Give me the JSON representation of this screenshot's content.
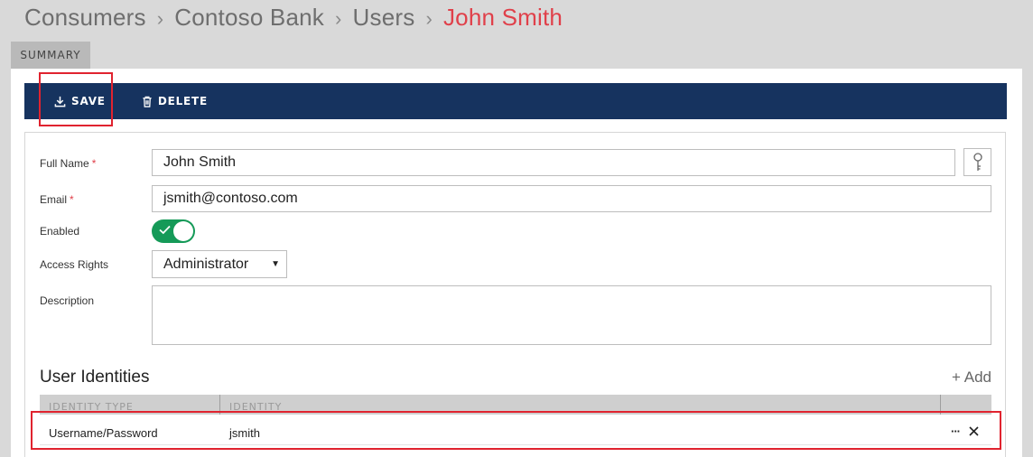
{
  "breadcrumb": {
    "items": [
      "Consumers",
      "Contoso Bank",
      "Users"
    ],
    "current": "John Smith",
    "separator": "›"
  },
  "tabs": {
    "summary": "SUMMARY"
  },
  "toolbar": {
    "save_label": "SAVE",
    "delete_label": "DELETE"
  },
  "form": {
    "full_name": {
      "label": "Full Name",
      "required_mark": "*",
      "value": "John Smith"
    },
    "email": {
      "label": "Email",
      "required_mark": "*",
      "value": "jsmith@contoso.com"
    },
    "enabled": {
      "label": "Enabled",
      "value": true
    },
    "access_rights": {
      "label": "Access Rights",
      "value": "Administrator"
    },
    "description": {
      "label": "Description",
      "value": ""
    }
  },
  "identities": {
    "title": "User Identities",
    "add_label": "+ Add",
    "columns": [
      "IDENTITY TYPE",
      "IDENTITY"
    ],
    "rows": [
      {
        "type": "Username/Password",
        "identity": "jsmith"
      }
    ]
  },
  "colors": {
    "toolbar_bg": "#16335f",
    "accent_red": "#e0404a",
    "toggle_on": "#159a58",
    "highlight_box": "#e0232f"
  },
  "icons": {
    "save": "download-icon",
    "delete": "trash-icon",
    "key": "key-icon",
    "more": "ellipsis-icon",
    "remove": "close-icon",
    "toggle_check": "check-icon",
    "dropdown": "caret-down-icon"
  }
}
